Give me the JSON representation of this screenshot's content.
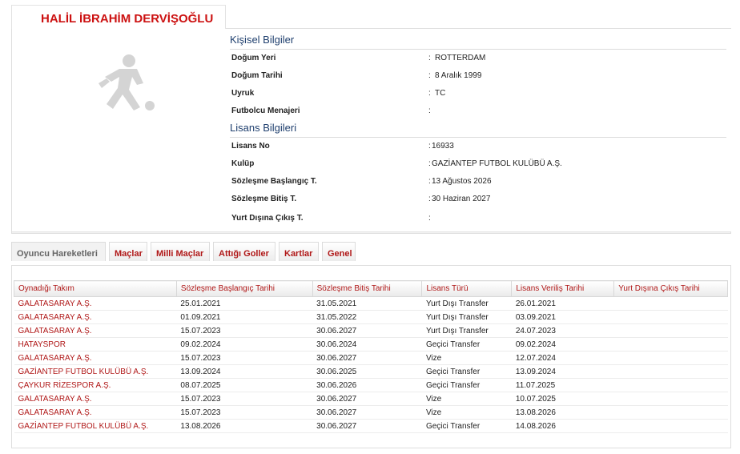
{
  "player": {
    "name": "HALİL İBRAHİM DERVİŞOĞLU",
    "avatar_icon": "player-silhouette-icon"
  },
  "personal": {
    "title": "Kişisel Bilgiler",
    "rows": [
      {
        "label": "Doğum Yeri",
        "value": "ROTTERDAM"
      },
      {
        "label": "Doğum Tarihi",
        "value": "8 Aralık 1999"
      },
      {
        "label": "Uyruk",
        "value": "TC"
      },
      {
        "label": "Futbolcu Menajeri",
        "value": ""
      }
    ]
  },
  "license": {
    "title": "Lisans Bilgileri",
    "rows": [
      {
        "label": "Lisans No",
        "value": "16933"
      },
      {
        "label": "Kulüp",
        "value": "GAZİANTEP FUTBOL KULÜBÜ A.Ş."
      },
      {
        "label": "Sözleşme Başlangıç T.",
        "value": "13 Ağustos 2026"
      },
      {
        "label": "Sözleşme Bitiş T.",
        "value": "30 Haziran 2027"
      },
      {
        "label": "Yurt Dışına Çıkış T.",
        "value": ""
      }
    ]
  },
  "tabs": [
    {
      "label": "Oyuncu Hareketleri",
      "active": true
    },
    {
      "label": "Maçlar",
      "active": false
    },
    {
      "label": "Milli Maçlar",
      "active": false
    },
    {
      "label": "Attığı Goller",
      "active": false
    },
    {
      "label": "Kartlar",
      "active": false
    },
    {
      "label": "Genel",
      "active": false
    }
  ],
  "movements": {
    "columns": [
      "Oynadığı Takım",
      "Sözleşme Başlangıç Tarihi",
      "Sözleşme Bitiş Tarihi",
      "Lisans Türü",
      "Lisans Veriliş Tarihi",
      "Yurt Dışına Çıkış Tarihi"
    ],
    "rows": [
      [
        "GALATASARAY A.Ş.",
        "25.01.2021",
        "31.05.2021",
        "Yurt Dışı Transfer",
        "26.01.2021",
        ""
      ],
      [
        "GALATASARAY A.Ş.",
        "01.09.2021",
        "31.05.2022",
        "Yurt Dışı Transfer",
        "03.09.2021",
        ""
      ],
      [
        "GALATASARAY A.Ş.",
        "15.07.2023",
        "30.06.2027",
        "Yurt Dışı Transfer",
        "24.07.2023",
        ""
      ],
      [
        "HATAYSPOR",
        "09.02.2024",
        "30.06.2024",
        "Geçici Transfer",
        "09.02.2024",
        ""
      ],
      [
        "GALATASARAY A.Ş.",
        "15.07.2023",
        "30.06.2027",
        "Vize",
        "12.07.2024",
        ""
      ],
      [
        "GAZİANTEP FUTBOL KULÜBÜ A.Ş.",
        "13.09.2024",
        "30.06.2025",
        "Geçici Transfer",
        "13.09.2024",
        ""
      ],
      [
        "ÇAYKUR RİZESPOR A.Ş.",
        "08.07.2025",
        "30.06.2026",
        "Geçici Transfer",
        "11.07.2025",
        ""
      ],
      [
        "GALATASARAY A.Ş.",
        "15.07.2023",
        "30.06.2027",
        "Vize",
        "10.07.2025",
        ""
      ],
      [
        "GALATASARAY A.Ş.",
        "15.07.2023",
        "30.06.2027",
        "Vize",
        "13.08.2026",
        ""
      ],
      [
        "GAZİANTEP FUTBOL KULÜBÜ A.Ş.",
        "13.08.2026",
        "30.06.2027",
        "Geçici Transfer",
        "14.08.2026",
        ""
      ]
    ]
  },
  "colors": {
    "accent_red": "#cc1111",
    "section_blue": "#1f3f6e"
  }
}
